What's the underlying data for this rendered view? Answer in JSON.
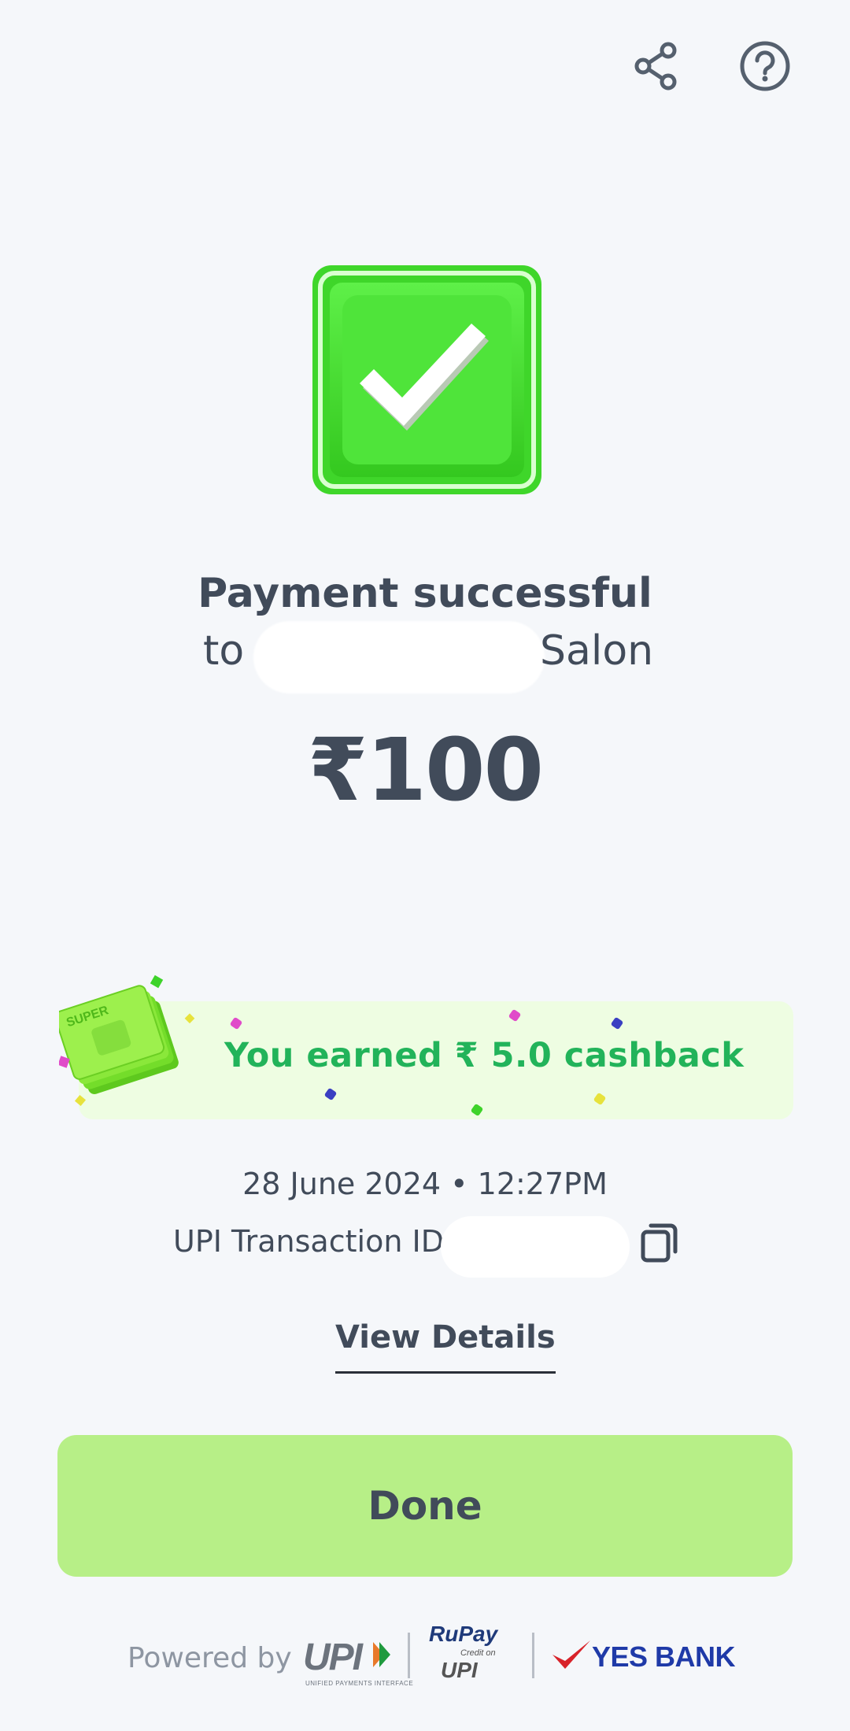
{
  "header": {
    "share_icon": "share-icon",
    "help_icon": "help-circle-icon"
  },
  "status": {
    "icon": "check-box-icon",
    "title": "Payment successful",
    "to_prefix": "to",
    "recipient_suffix": "Salon",
    "amount": "₹100"
  },
  "cashback": {
    "text": "You earned ₹ 5.0 cashback",
    "badge_text": "SUPER"
  },
  "transaction": {
    "datetime": "28 June 2024 • 12:27PM",
    "upi_label": "UPI Transaction ID:",
    "copy_icon": "copy-icon"
  },
  "actions": {
    "view_details": "View Details",
    "done": "Done"
  },
  "footer": {
    "powered_by": "Powered by",
    "upi_logo_text": "UPI",
    "upi_logo_subtext": "UNIFIED PAYMENTS INTERFACE",
    "rupay_text": "RuPay",
    "rupay_credit_text": "Credit on",
    "rupay_upi_text": "UPI",
    "bank": "YES BANK"
  },
  "colors": {
    "background": "#f5f7fa",
    "success_green": "#3ed32a",
    "cashback_text": "#22b35a",
    "cashback_bg": "#eefde2",
    "done_button": "#b7ef87",
    "text": "#414b5a",
    "bank_blue": "#1f3aa8",
    "bank_red": "#d8232a"
  }
}
